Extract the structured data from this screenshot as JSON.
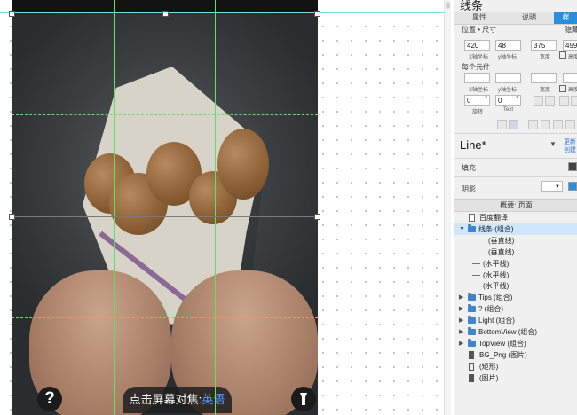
{
  "canvas": {
    "help_label": "?",
    "focus_text": "点击屏幕对焦:",
    "focus_lang": "英语"
  },
  "inspector": {
    "title": "线条",
    "tabs": [
      "属性",
      "说明",
      "样"
    ],
    "pos_size_label": "位置 • 尺寸",
    "hidden_label": "隐藏",
    "x_value": "420",
    "y_value": "48",
    "w_value": "375",
    "h_value": "499",
    "x_caption": "X轴坐标",
    "y_caption": "y轴坐标",
    "w_caption": "宽度",
    "h_caption": "高度",
    "per_element_label": "每个元件",
    "x_caption2": "X轴坐标",
    "y_caption2": "y轴坐标",
    "w_caption2": "宽度",
    "h_caption2": "高度",
    "rotate_value": "0",
    "text_rotate_value": "0",
    "rotate_caption": "旋转",
    "text_caption": "Text",
    "degree_symbol": "°",
    "widget_name": "Line*",
    "link_more": "更新",
    "link_create": "创建",
    "fill_label": "填充",
    "shadow_label": "阴影",
    "outline_header": "概要: 页面"
  },
  "outline": [
    {
      "label": "百度翻译",
      "icon": "page-icon",
      "indent": 1,
      "arrow": ""
    },
    {
      "label": "线条 (组合)",
      "icon": "folder-icon",
      "indent": 1,
      "arrow": "▼",
      "selected": true
    },
    {
      "label": "(垂直线)",
      "icon": "vertical-line-icon",
      "indent": 3,
      "arrow": ""
    },
    {
      "label": "(垂直线)",
      "icon": "vertical-line-icon",
      "indent": 3,
      "arrow": ""
    },
    {
      "label": "(水平线)",
      "icon": "horizontal-line-icon",
      "indent": 2,
      "arrow": ""
    },
    {
      "label": "(水平线)",
      "icon": "horizontal-line-icon",
      "indent": 2,
      "arrow": ""
    },
    {
      "label": "(水平线)",
      "icon": "horizontal-line-icon",
      "indent": 2,
      "arrow": ""
    },
    {
      "label": "Tips (组合)",
      "icon": "folder-icon",
      "indent": 1,
      "arrow": "▶"
    },
    {
      "label": "? (组合)",
      "icon": "folder-icon",
      "indent": 1,
      "arrow": "▶"
    },
    {
      "label": "Light (组合)",
      "icon": "folder-icon",
      "indent": 1,
      "arrow": "▶"
    },
    {
      "label": "BottomView (组合)",
      "icon": "folder-icon",
      "indent": 1,
      "arrow": "▶"
    },
    {
      "label": "TopView (组合)",
      "icon": "folder-icon",
      "indent": 1,
      "arrow": "▶"
    },
    {
      "label": "BG_Png (图片)",
      "icon": "image-icon",
      "indent": 1,
      "arrow": ""
    },
    {
      "label": "(矩形)",
      "icon": "rectangle-icon",
      "indent": 1,
      "arrow": ""
    },
    {
      "label": "(图片)",
      "icon": "image-icon",
      "indent": 1,
      "arrow": ""
    }
  ],
  "colors": {
    "guide_green": "#5fe25f",
    "guide_cyan": "#6fe0ea",
    "accent_blue": "#2a8fdb",
    "selection_row": "#cfe6fb",
    "folder_blue": "#3f86c9",
    "language_blue": "#4f9cff"
  }
}
